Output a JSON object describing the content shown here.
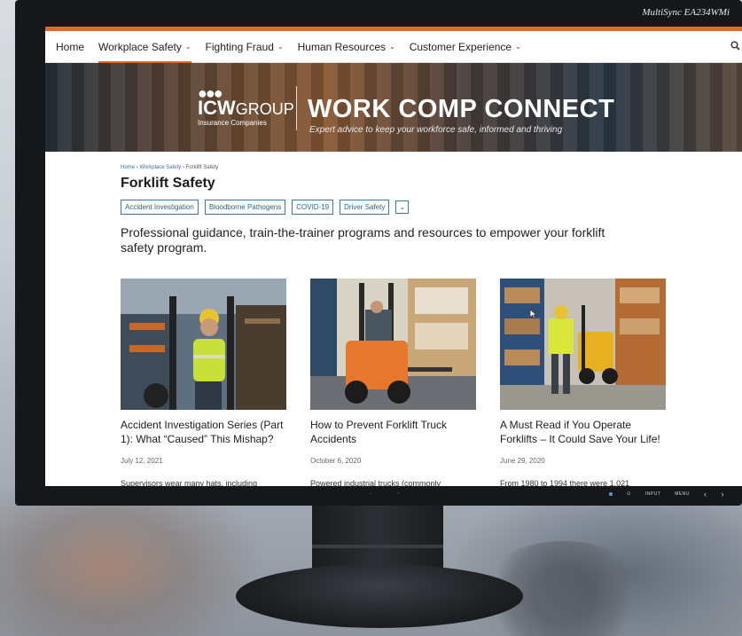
{
  "monitor": {
    "brand": "MultiSync EA234WMi"
  },
  "nav": {
    "items": [
      {
        "label": "Home",
        "chevron": false,
        "active": false
      },
      {
        "label": "Workplace Safety",
        "chevron": true,
        "active": true
      },
      {
        "label": "Fighting Fraud",
        "chevron": true,
        "active": false
      },
      {
        "label": "Human Resources",
        "chevron": true,
        "active": false
      },
      {
        "label": "Customer Experience",
        "chevron": true,
        "active": false
      }
    ],
    "search_icon": "search-icon"
  },
  "banner": {
    "logo_dots": "●●●",
    "logo_brand": "ICW",
    "logo_group": "GROUP",
    "logo_sub": "Insurance Companies",
    "title": "WORK COMP CONNECT",
    "tagline": "Expert advice to keep your workforce safe, informed and thriving"
  },
  "breadcrumb": {
    "home": "Home",
    "section": "Workplace Safety",
    "current": "Forklift Safety",
    "separator": "›"
  },
  "page": {
    "title": "Forklift Safety",
    "intro": "Professional guidance, train-the-trainer programs and resources to empower your forklift safety program."
  },
  "tags": [
    "Accident Investigation",
    "Bloodborne Pathogens",
    "COVID-19",
    "Driver Safety"
  ],
  "tag_more": "⌄",
  "cards": [
    {
      "title": "Accident Investigation Series (Part 1): What “Caused” This Mishap?",
      "date": "July 12, 2021",
      "excerpt": "Supervisors wear many hats, including"
    },
    {
      "title": "How to Prevent Forklift Truck Accidents",
      "date": "October 6, 2020",
      "excerpt": "Powered industrial trucks (commonly"
    },
    {
      "title": "A Must Read if You Operate Forklifts – It Could Save Your Life!",
      "date": "June 29, 2020",
      "excerpt": "From 1980 to 1994 there were 1,021"
    }
  ],
  "controls": {
    "input": "INPUT",
    "menu": "MENU",
    "left": "‹",
    "right": "›",
    "power": "⏻"
  },
  "colors": {
    "accent": "#e2672a",
    "link": "#3b6ea5",
    "tag_border": "#3b77aa"
  }
}
